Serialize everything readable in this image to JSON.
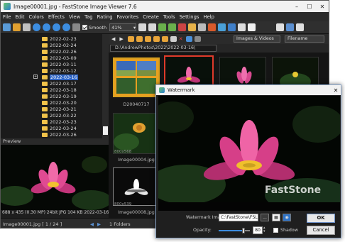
{
  "app": {
    "title": "Image00001.jpg - FastStone Image Viewer 7.6",
    "controls": [
      "–",
      "☐",
      "✕"
    ]
  },
  "menu": [
    "File",
    "Edit",
    "Colors",
    "Effects",
    "View",
    "Tag",
    "Rating",
    "Favorites",
    "Create",
    "Tools",
    "Settings",
    "Help"
  ],
  "toolbar": {
    "smooth_label": "Smooth",
    "zoom_value": "41%"
  },
  "tree": {
    "folders": [
      "2022-02-23",
      "2022-02-24",
      "2022-02-26",
      "2022-03-09",
      "2022-03-11",
      "2022-03-12",
      "2022-03-16",
      "2022-03-17",
      "2022-03-18",
      "2022-03-19",
      "2022-03-20",
      "2022-03-21",
      "2022-03-22",
      "2022-03-23",
      "2022-03-24",
      "2022-03-26"
    ],
    "selected": "2022-03-16"
  },
  "preview": {
    "header": "Preview",
    "info": "688 x 435 (0.30 MP)  24bit  JPG   104 KB  2022-03-16  1:1"
  },
  "status": {
    "file": "Image00001.jpg [ 1 / 24 ]",
    "folders": "1 Folders"
  },
  "browser": {
    "path": "D:\\AndrewPhotos\\2022\\2022-03-16\\",
    "filter": "Images & Videos",
    "sort": "Filename",
    "thumbs": [
      {
        "name": "D20040717",
        "info": ""
      },
      {
        "name": "Image00004.jpg",
        "info": "800x568"
      },
      {
        "name": "Image00008.jpg",
        "info": "800x539"
      }
    ]
  },
  "dialog": {
    "title": "Watermark",
    "image_label": "Watermark Image:",
    "image_path": "C:\\FastStone\\FSLogo.",
    "browse": "...",
    "opacity_label": "Opacity:",
    "opacity_value": "80",
    "opacity_fraction": 0.8,
    "shadow_label": "Shadow",
    "ok": "OK",
    "cancel": "Cancel",
    "watermark_text": "FastStone"
  }
}
